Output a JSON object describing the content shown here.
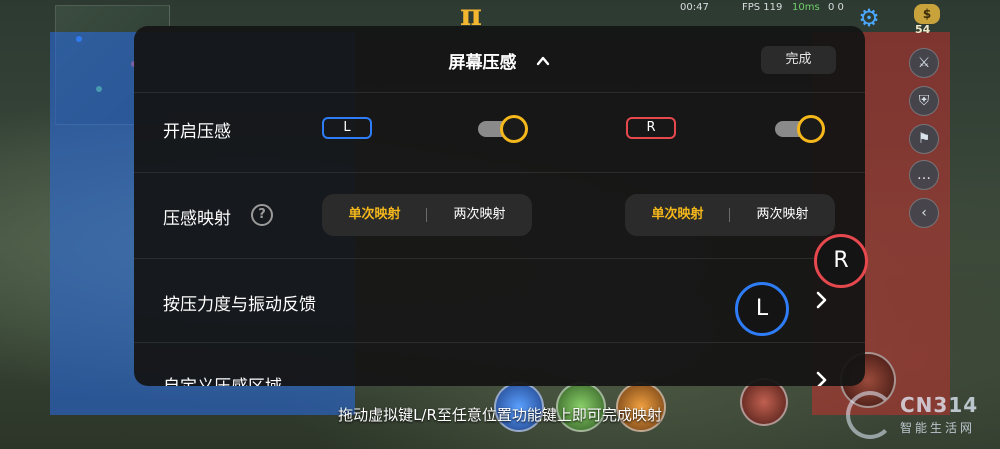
{
  "panel": {
    "title": "屏幕压感",
    "done_label": "完成",
    "rows": {
      "enable": {
        "label": "开启压感",
        "left_key": "L",
        "right_key": "R",
        "left_toggle_on": true,
        "right_toggle_on": true
      },
      "mapping": {
        "label": "压感映射",
        "left_options": [
          "单次映射",
          "两次映射"
        ],
        "right_options": [
          "单次映射",
          "两次映射"
        ],
        "selected": "单次映射"
      },
      "feedback": {
        "label": "按压力度与振动反馈"
      },
      "custom_area": {
        "label": "自定义压感区域"
      }
    }
  },
  "overlay": {
    "left_key": "L",
    "right_key": "R",
    "hint": "拖动虚拟键L/R至任意位置功能键上即可完成映射"
  },
  "status_bar": {
    "time": "00:47",
    "fps": "FPS 119",
    "latency": "10ms",
    "counts": "0  0"
  },
  "game_hud": {
    "coin_count": "54"
  },
  "watermark": {
    "brand": "CN314",
    "subtitle": "智能生活网"
  },
  "colors": {
    "accent": "#f5b81c",
    "left_key": "#2e7cf6",
    "right_key": "#e5484d",
    "panel_bg": "#141414"
  }
}
